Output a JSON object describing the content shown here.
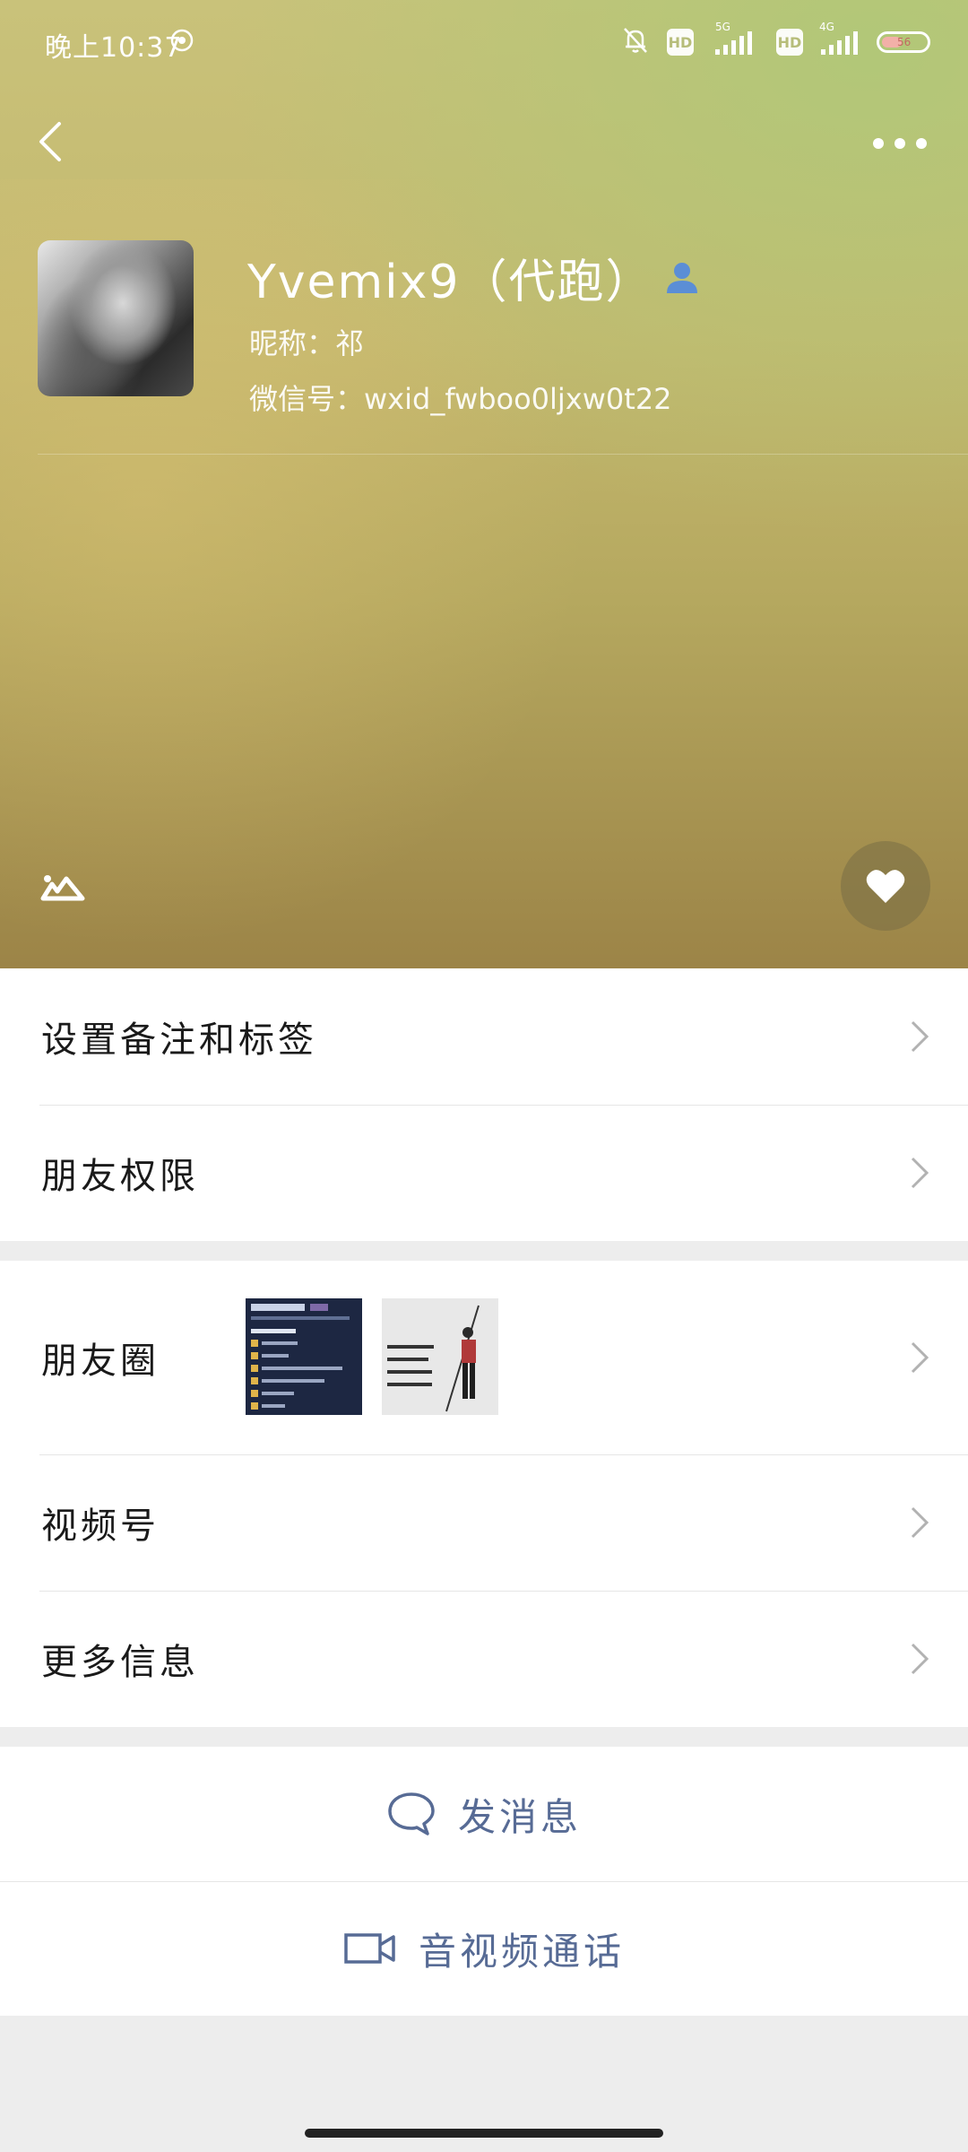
{
  "status_bar": {
    "time": "晚上10:37",
    "hd_1": "HD",
    "hd_2": "HD",
    "net_1": "5G",
    "net_2": "4G",
    "battery_text": "56"
  },
  "header": {
    "back_icon": "chevron-left-icon",
    "more_icon": "more-horizontal-icon"
  },
  "profile": {
    "name": "Yvemix9（代跑）",
    "nickname": "昵称：祁",
    "wechat_id": "微信号：wxid_fwboo0ljxw0t22",
    "contact_icon": "person-icon"
  },
  "list_group_1": {
    "items": [
      {
        "label": "设置备注和标签"
      },
      {
        "label": "朋友权限"
      }
    ]
  },
  "list_group_2": {
    "items": [
      {
        "label": "朋友圈"
      },
      {
        "label": "视频号"
      },
      {
        "label": "更多信息"
      }
    ]
  },
  "actions": {
    "message": "发消息",
    "call": "音视频通话"
  },
  "colors": {
    "accent": "#576b95",
    "page_bg": "#ededed"
  }
}
